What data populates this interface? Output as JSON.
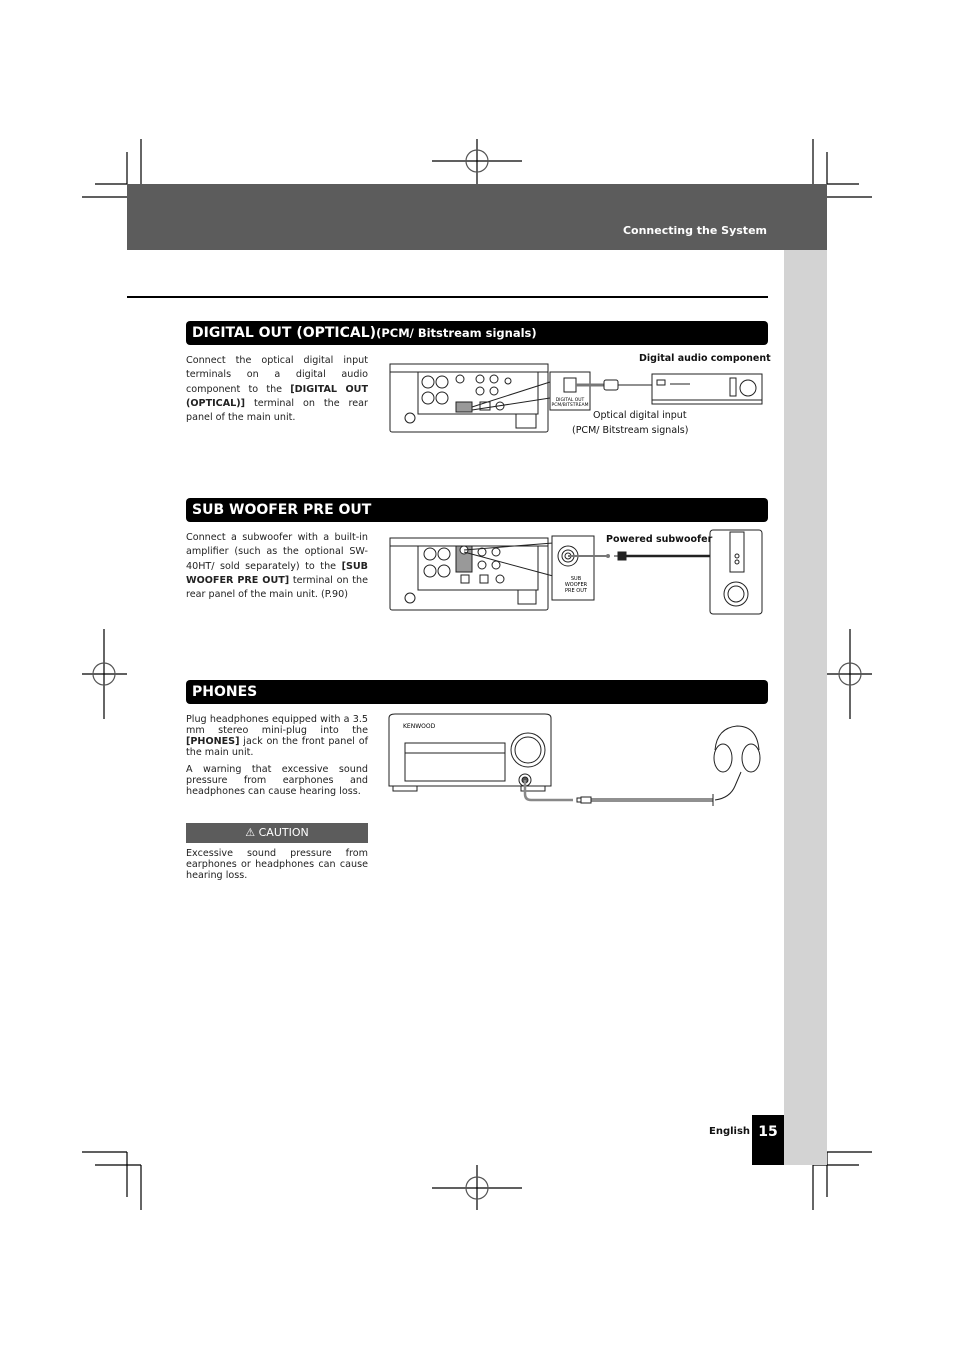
{
  "header": {
    "title": "Connecting the System"
  },
  "sections": [
    {
      "title": "DIGITAL OUT (OPTICAL)",
      "subtitle": "(PCM/ Bitstream signals)",
      "body_pre": "Connect the optical digital input terminals on a digital audio component to the ",
      "body_bold": "[DIGITAL OUT (OPTICAL)]",
      "body_post": " terminal on the rear panel of the main unit.",
      "diagram": {
        "device_label": "Digital audio component",
        "terminal_label_1": "DIGITAL OUT",
        "terminal_label_2": "PCM/BITSTREAM",
        "caption_1": "Optical digital input",
        "caption_2": "(PCM/ Bitstream signals)"
      }
    },
    {
      "title": "SUB WOOFER PRE OUT",
      "body_pre": "Connect a subwoofer with a built-in amplifier (such as the optional SW-40HT/ sold separately) to the ",
      "body_bold": "[SUB WOOFER PRE OUT]",
      "body_post": " terminal on the rear panel of the main unit. (P.90)",
      "diagram": {
        "device_label": "Powered subwoofer",
        "terminal_label_1": "SUB",
        "terminal_label_2": "WOOFER",
        "terminal_label_3": "PRE OUT"
      }
    },
    {
      "title": "PHONES",
      "body_pre": "Plug headphones equipped with a 3.5 mm stereo mini-plug into the ",
      "body_bold": "[PHONES]",
      "body_post": " jack on the front panel of the main unit.",
      "body_2": "A warning that excessive sound pressure from earphones and headphones can cause hearing loss.",
      "diagram": {
        "brand": "KENWOOD"
      }
    }
  ],
  "caution": {
    "icon": "warning-triangle-icon",
    "label": "CAUTION",
    "text": "Excessive sound pressure from earphones or headphones can cause hearing loss."
  },
  "footer": {
    "language": "English",
    "page_number": "15"
  }
}
